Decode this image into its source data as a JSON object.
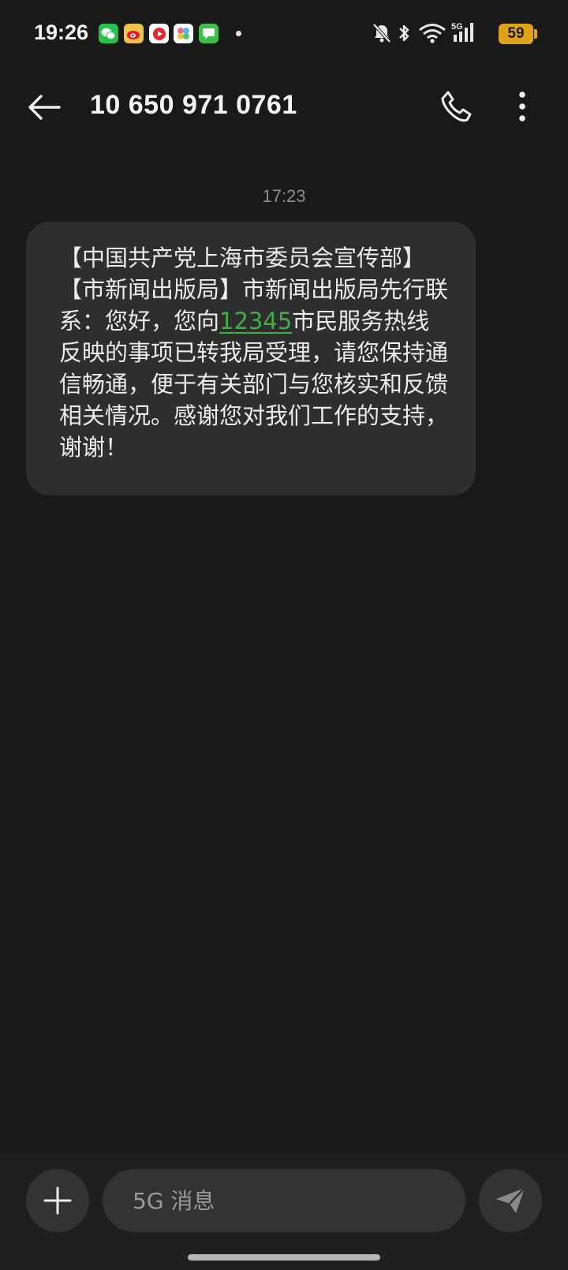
{
  "status_bar": {
    "time": "19:26",
    "battery": "59",
    "network": "5G",
    "app_icons": [
      "wechat-icon",
      "weibo-icon",
      "video-app-icon",
      "gallery-app-icon",
      "messages-app-icon"
    ],
    "system_icons": [
      "mute-icon",
      "bluetooth-icon",
      "wifi-icon",
      "signal-icon"
    ]
  },
  "header": {
    "contact": "10 650 971 0761",
    "back_icon": "arrow-left-icon",
    "call_icon": "phone-icon",
    "more_icon": "more-vertical-icon"
  },
  "conversation": {
    "timestamp": "17:23",
    "messages": [
      {
        "text_before": "【中国共产党上海市委员会宣传部】【市新闻出版局】市新闻出版局先行联系：您好，您向",
        "link": "12345",
        "text_after": "市民服务热线反映的事项已转我局受理，请您保持通信畅通，便于有关部门与您核实和反馈相关情况。感谢您对我们工作的支持，谢谢！"
      }
    ]
  },
  "composer": {
    "placeholder": "5G 消息",
    "add_icon": "plus-icon",
    "send_icon": "send-icon"
  },
  "colors": {
    "background": "#191919",
    "bubble": "#2e2e2e",
    "link": "#3fae49",
    "battery": "#e0a21b"
  }
}
